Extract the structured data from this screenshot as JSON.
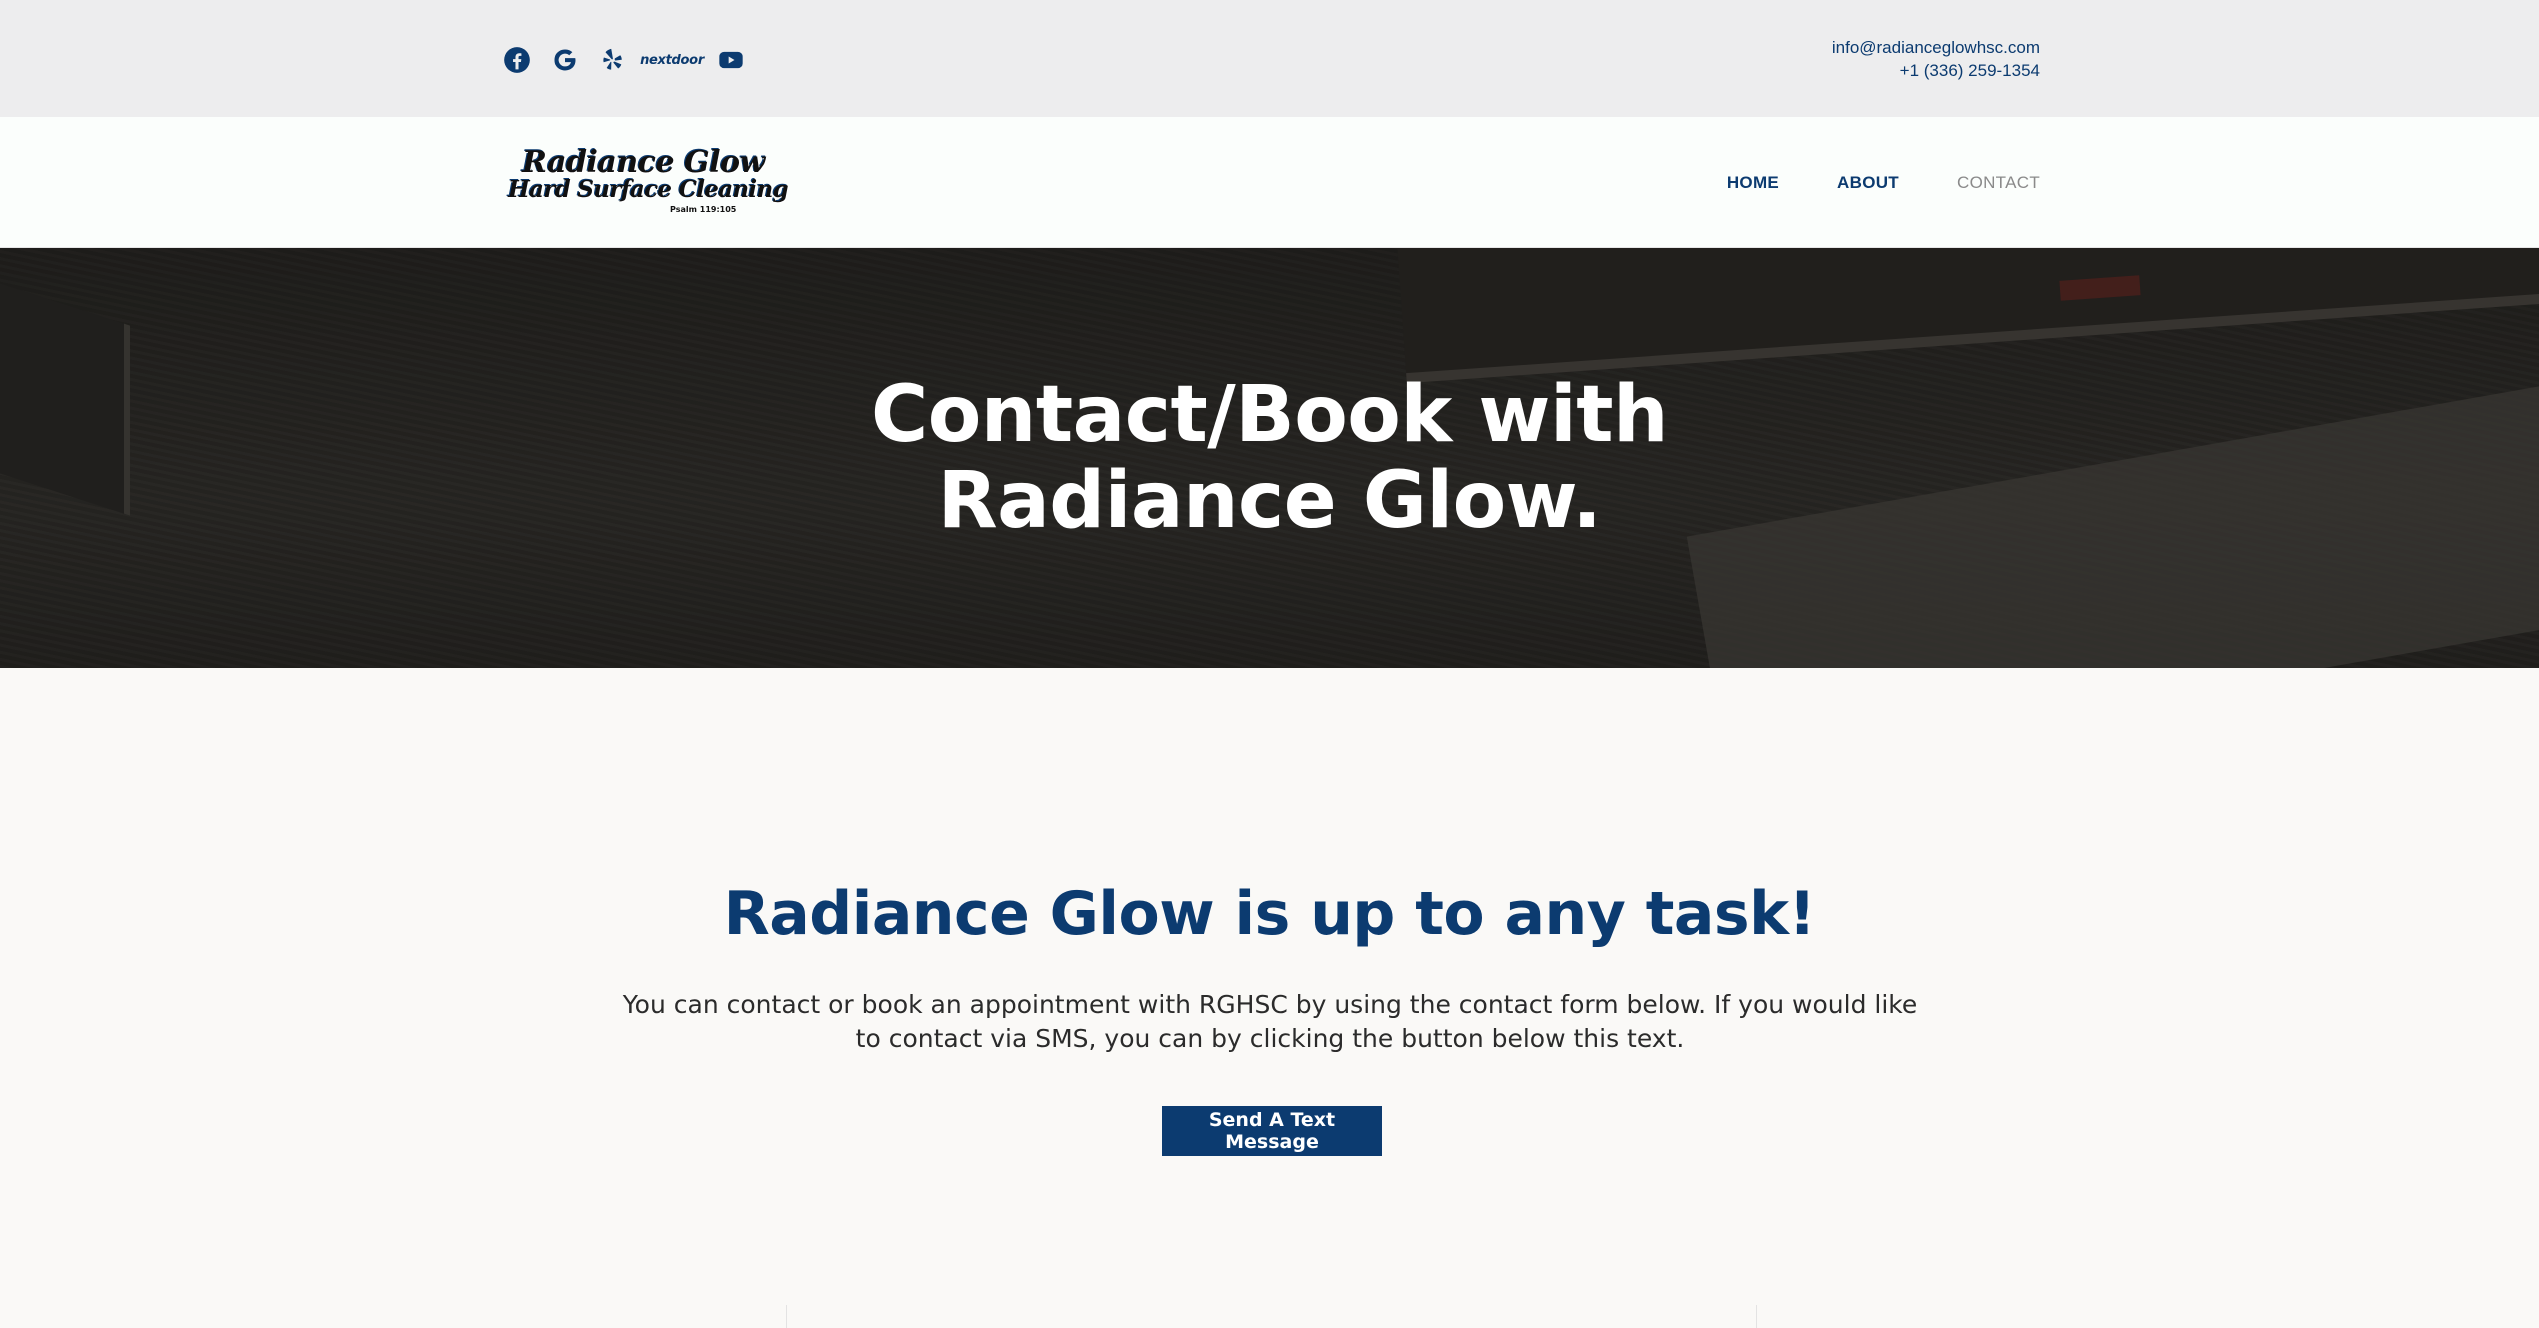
{
  "colors": {
    "brand": "#0c3b70",
    "topbar_bg": "#ededee",
    "page_bg": "#faf9f7",
    "hero_text": "#ffffff"
  },
  "topbar": {
    "social_icons": [
      "facebook-icon",
      "google-icon",
      "yelp-icon",
      "nextdoor-icon",
      "youtube-icon"
    ],
    "nextdoor_label": "nextdoor",
    "email": "info@radianceglowhsc.com",
    "phone": "+1 (336) 259-1354"
  },
  "logo": {
    "line1": "Radiance Glow",
    "line2": "Hard Surface Cleaning",
    "line3": "Psalm 119:105"
  },
  "nav": {
    "home": "HOME",
    "about": "ABOUT",
    "contact": "CONTACT"
  },
  "hero": {
    "title_line1": "Contact/Book with",
    "title_line2": "Radiance Glow."
  },
  "main": {
    "heading": "Radiance Glow is up to any task!",
    "body": "You can contact or book an appointment with RGHSC by using the contact form below. If you would like to contact via SMS, you can by clicking the button below this text.",
    "cta_label": "Send A Text Message"
  }
}
